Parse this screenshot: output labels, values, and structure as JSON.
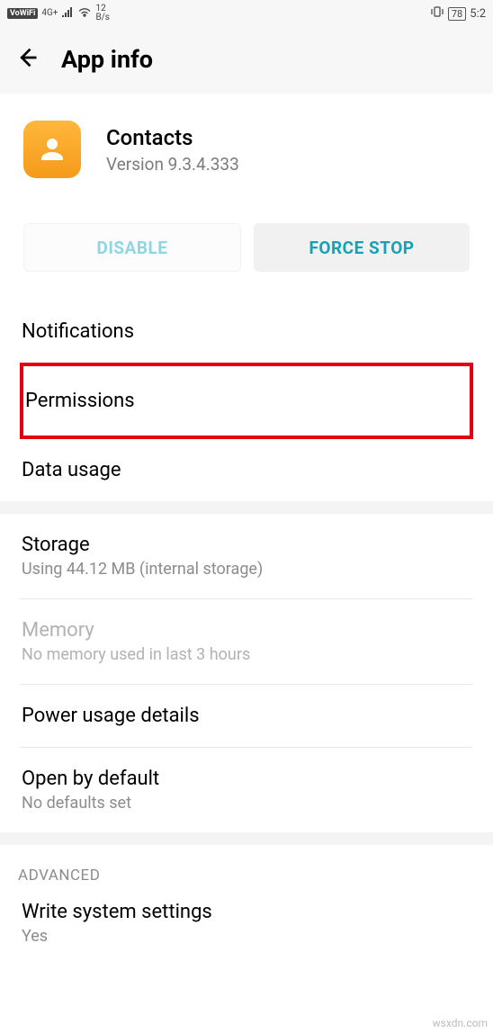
{
  "status": {
    "vowifi": "VoWiFi",
    "signal_4g": "4G+",
    "speed_top": "12",
    "speed_unit": "B/s",
    "battery": "78",
    "time": "5:2"
  },
  "header": {
    "title": "App info"
  },
  "app": {
    "name": "Contacts",
    "version": "Version 9.3.4.333"
  },
  "buttons": {
    "disable": "DISABLE",
    "force_stop": "FORCE STOP"
  },
  "items": {
    "notifications": "Notifications",
    "permissions": "Permissions",
    "data_usage": "Data usage",
    "storage_title": "Storage",
    "storage_sub": "Using 44.12 MB (internal storage)",
    "memory_title": "Memory",
    "memory_sub": "No memory used in last 3 hours",
    "power": "Power usage details",
    "open_default_title": "Open by default",
    "open_default_sub": "No defaults set",
    "advanced_header": "ADVANCED",
    "write_title": "Write system settings",
    "write_sub": "Yes"
  },
  "watermark": "wsxdn.com"
}
